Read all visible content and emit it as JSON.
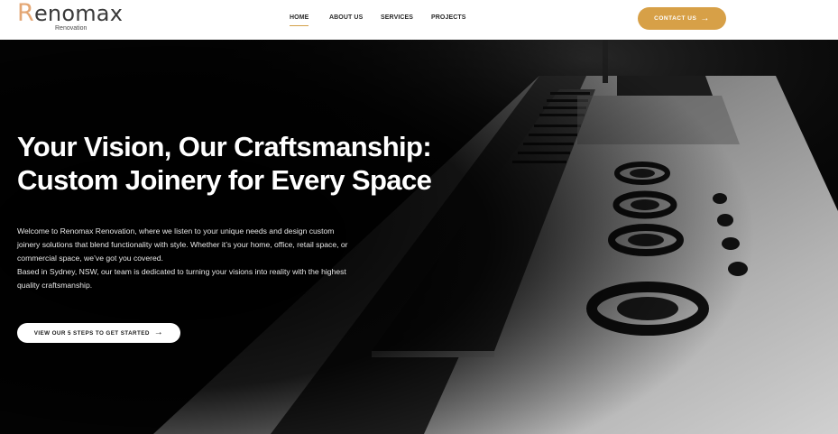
{
  "brand": {
    "initial": "R",
    "rest": "enomax",
    "tagline": "Renovation"
  },
  "nav": {
    "items": [
      {
        "label": "HOME",
        "active": true
      },
      {
        "label": "ABOUT US",
        "active": false
      },
      {
        "label": "SERVICES",
        "active": false
      },
      {
        "label": "PROJECTS",
        "active": false
      }
    ],
    "contact_label": "CONTACT US",
    "contact_icon": "arrow-right-icon"
  },
  "hero": {
    "headline_line1": "Your Vision, Our Craftsmanship:",
    "headline_line2": "Custom Joinery for Every Space",
    "intro_1": "Welcome to Renomax Renovation, where we listen to your unique needs and design custom joinery solutions that blend functionality with style. Whether it’s your home, office, retail space, or commercial space, we’ve got you covered.",
    "intro_2": "Based in Sydney, NSW, our team is dedicated to turning your visions into reality with the highest quality craftsmanship.",
    "cta_label": "VIEW OUR 5 STEPS TO GET STARTED",
    "cta_icon": "arrow-right-icon",
    "image": "stainless-steel-kitchen-cooktop"
  },
  "colors": {
    "accent": "#d7a047",
    "logo_accent": "#e4a774",
    "header_bg": "#ffffff",
    "hero_bg": "#050505"
  }
}
